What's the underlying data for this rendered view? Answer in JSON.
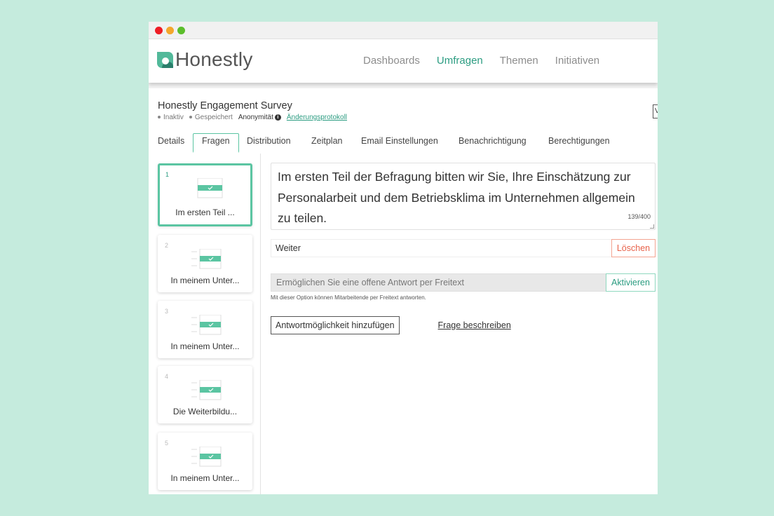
{
  "brand": {
    "name": "Honestly",
    "accent": "#2b9c81",
    "accent_light": "#5bc5a2",
    "danger": "#e8624a"
  },
  "nav": {
    "items": [
      {
        "label": "Dashboards",
        "active": false
      },
      {
        "label": "Umfragen",
        "active": true
      },
      {
        "label": "Themen",
        "active": false
      },
      {
        "label": "Initiativen",
        "active": false
      }
    ]
  },
  "survey": {
    "title": "Honestly Engagement Survey",
    "status": "Inaktiv",
    "saved": "Gespeichert",
    "anonymity": "Anonymität",
    "changelog": "Änderungsprotokoll",
    "edge_button": "V"
  },
  "tabs": [
    "Details",
    "Fragen",
    "Distribution",
    "Zeitplan",
    "Email Einstellungen",
    "Benachrichtigung",
    "Berechtigungen"
  ],
  "active_tab": "Fragen",
  "questions": [
    {
      "num": "1",
      "label": "Im ersten Teil ...",
      "selected": true
    },
    {
      "num": "2",
      "label": "In meinem Unter...",
      "selected": false
    },
    {
      "num": "3",
      "label": "In meinem Unter...",
      "selected": false
    },
    {
      "num": "4",
      "label": "Die Weiterbildu...",
      "selected": false
    },
    {
      "num": "5",
      "label": "In meinem Unter...",
      "selected": false
    }
  ],
  "editor": {
    "question_text": "Im ersten Teil der Befragung bitten wir Sie, Ihre Einschätzung zur Personalarbeit und dem Betriebsklima im Unternehmen allgemein zu teilen.",
    "char_count": "139/400",
    "answer_option": "Weiter",
    "delete_label": "Löschen",
    "freetext_label": "Ermöglichen Sie eine offene Antwort per Freitext",
    "activate_label": "Aktivieren",
    "freetext_hint": "Mit dieser Option können Mitarbeitende per Freitext antworten.",
    "add_answer_label": "Antwortmöglichkeit hinzufügen",
    "describe_label": "Frage beschreiben"
  }
}
